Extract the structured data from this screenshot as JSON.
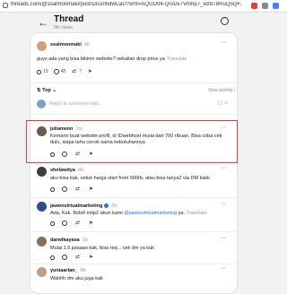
{
  "browser": {
    "url": "threads.com/@ssalmonmaki/post/DIsxnhdwCaU?xmt=AQGD04-QrvDv7Vrnhp7_wzbT8RuQ5QF..."
  },
  "header": {
    "title": "Thread",
    "views": "5th views"
  },
  "post": {
    "username": "ssalmonmaki",
    "time": "4h",
    "text": "guys ada yang bisa bikinin website? sekalian drop price ya",
    "translate": "Translate",
    "likes": "19",
    "comments": "48",
    "reposts": "7"
  },
  "sort": {
    "label": "Top",
    "activity": "View activity"
  },
  "reply_box": {
    "placeholder": "Reply to ssalmonmaki..."
  },
  "replies": [
    {
      "username": "julianwon",
      "time": "1m",
      "text": "Kemarin buat website profil, di IDwebhost mulai dari 700 ribuan. Bisa coba cek dulu, siapa tahu cocok sama kebutuhannya"
    },
    {
      "username": "shelawdya",
      "time": "4h",
      "text": "aku bisa kak, untuk harga start from 500rb, atau bisa tanya2 via DM kakk"
    },
    {
      "username": "jawonvirtualmarketing",
      "time": "3h",
      "text_pre": "Ada, Kak. Boleh intip2 akun kami ",
      "mention": "@jawonvirtualmarketing",
      "text_post": " ya.",
      "translate": "Translate"
    },
    {
      "username": "darwikayasa",
      "time": "1h",
      "text": "Mulai 1.5 jutaaan kak, bisa req... cek dm ya kak"
    },
    {
      "username": "yuniaarlan_",
      "time": "8h",
      "text": "Wahhh dm aku juga kak"
    }
  ],
  "colors": {
    "accent": "#1877f2",
    "highlight": "#e23b3b"
  }
}
